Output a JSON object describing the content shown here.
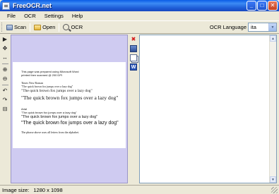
{
  "window": {
    "title": "FreeOCR.net",
    "minimize": "_",
    "maximize": "□",
    "close": "✕"
  },
  "menu": [
    "File",
    "OCR",
    "Settings",
    "Help"
  ],
  "toolbar": {
    "scan_label": "Scan",
    "open_label": "Open",
    "ocr_label": "OCR",
    "language_label": "OCR Language",
    "language_value": "ita",
    "dropdown_icon": "▼"
  },
  "left_tools": [
    {
      "name": "pointer-icon",
      "glyph": "▶"
    },
    {
      "name": "move-icon",
      "glyph": "✥"
    },
    {
      "name": "fit-width-icon",
      "glyph": "↔"
    },
    {
      "name": "zoom-in-icon",
      "glyph": "⊕"
    },
    {
      "name": "zoom-out-icon",
      "glyph": "⊖"
    },
    {
      "name": "rotate-left-icon",
      "glyph": "↶"
    },
    {
      "name": "rotate-right-icon",
      "glyph": "↷"
    },
    {
      "name": "select-region-icon",
      "glyph": "⊟"
    }
  ],
  "document": {
    "intro": "This page was prepared using Microsoft Word",
    "intro2": "printed then scanned @ 200 DPI",
    "times_heading": "Times New Roman",
    "t1": "\"The quick brown fox jumps over a lazy dog\"",
    "t2": "\"The quick brown fox jumps over a lazy dog\"",
    "t3": "\"The quick brown fox jumps over a lazy dog\"",
    "arial_heading": "Arial",
    "a1": "\"The quick brown fox jumps over a lazy dog\"",
    "a2": "\"The quick brown fox jumps over a lazy dog\"",
    "a3": "\"The quick brown fox jumps over a lazy dog\"",
    "footer": "The phrase above uses all letters from the alphabet."
  },
  "mid_tools": {
    "clear": "✖",
    "word": "W"
  },
  "status": {
    "label": "Image size:",
    "value": "1280 x 1098"
  }
}
